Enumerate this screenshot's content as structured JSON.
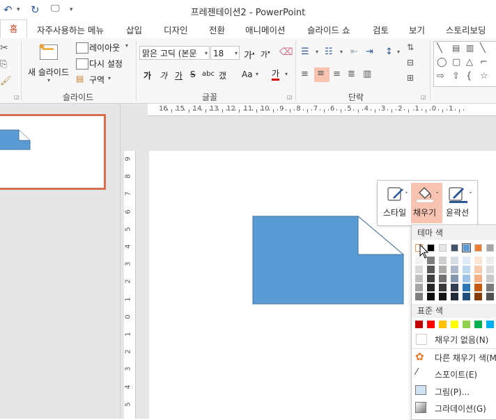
{
  "window": {
    "title": "프레젠테이션2 - PowerPoint"
  },
  "tabs": [
    "홈",
    "자주사용하는 메뉴",
    "삽입",
    "디자인",
    "전환",
    "애니메이션",
    "슬라이드 쇼",
    "검토",
    "보기",
    "스토리보딩"
  ],
  "ribbon": {
    "slides": {
      "new_slide": "새 슬라이드",
      "layout": "레이아웃",
      "reset": "다시 설정",
      "section": "구역",
      "group_label": "슬라이드"
    },
    "font": {
      "font_name": "맑은 고딕 (본문",
      "font_size": "18",
      "group_label": "글꼴",
      "bold": "가",
      "italic": "가",
      "underline": "가",
      "strike": "S",
      "shadow": "abc",
      "spacing": "갰",
      "case": "Aa",
      "color": "가"
    },
    "paragraph": {
      "group_label": "단락"
    }
  },
  "rulers": {
    "horizontal": [
      "16",
      "15",
      "14",
      "13",
      "12",
      "11",
      "10",
      "9",
      "8",
      "7",
      "6",
      "5",
      "4",
      "3",
      "2",
      "1",
      "0",
      "1"
    ],
    "vertical": [
      "9",
      "8",
      "7",
      "6",
      "5",
      "4",
      "3",
      "2",
      "1",
      "0",
      "1",
      "2",
      "3",
      "4",
      "5"
    ]
  },
  "mini_toolbar": {
    "style": "스타일",
    "fill": "채우기",
    "outline": "윤곽선"
  },
  "fill_menu": {
    "theme_colors": "테마 색",
    "standard_colors": "표준 색",
    "no_fill": "채우기 없음(N)",
    "more_colors": "다른 채우기 색(M",
    "eyedropper": "스포이트(E)",
    "picture": "그림(P)...",
    "gradient": "그라데이션(G)"
  },
  "colors": {
    "accent": "#c43e1c",
    "shape_fill": "#5b9bd5",
    "selection": "#f8c3b0",
    "theme_top": [
      "#ffffff",
      "#000000",
      "#e7e6e6",
      "#44546a",
      "#5b9bd5",
      "#ed7d31",
      "#a5a5a5"
    ],
    "standard": [
      "#c00000",
      "#ff0000",
      "#ffc000",
      "#ffff00",
      "#92d050",
      "#00b050",
      "#00b0f0"
    ]
  }
}
